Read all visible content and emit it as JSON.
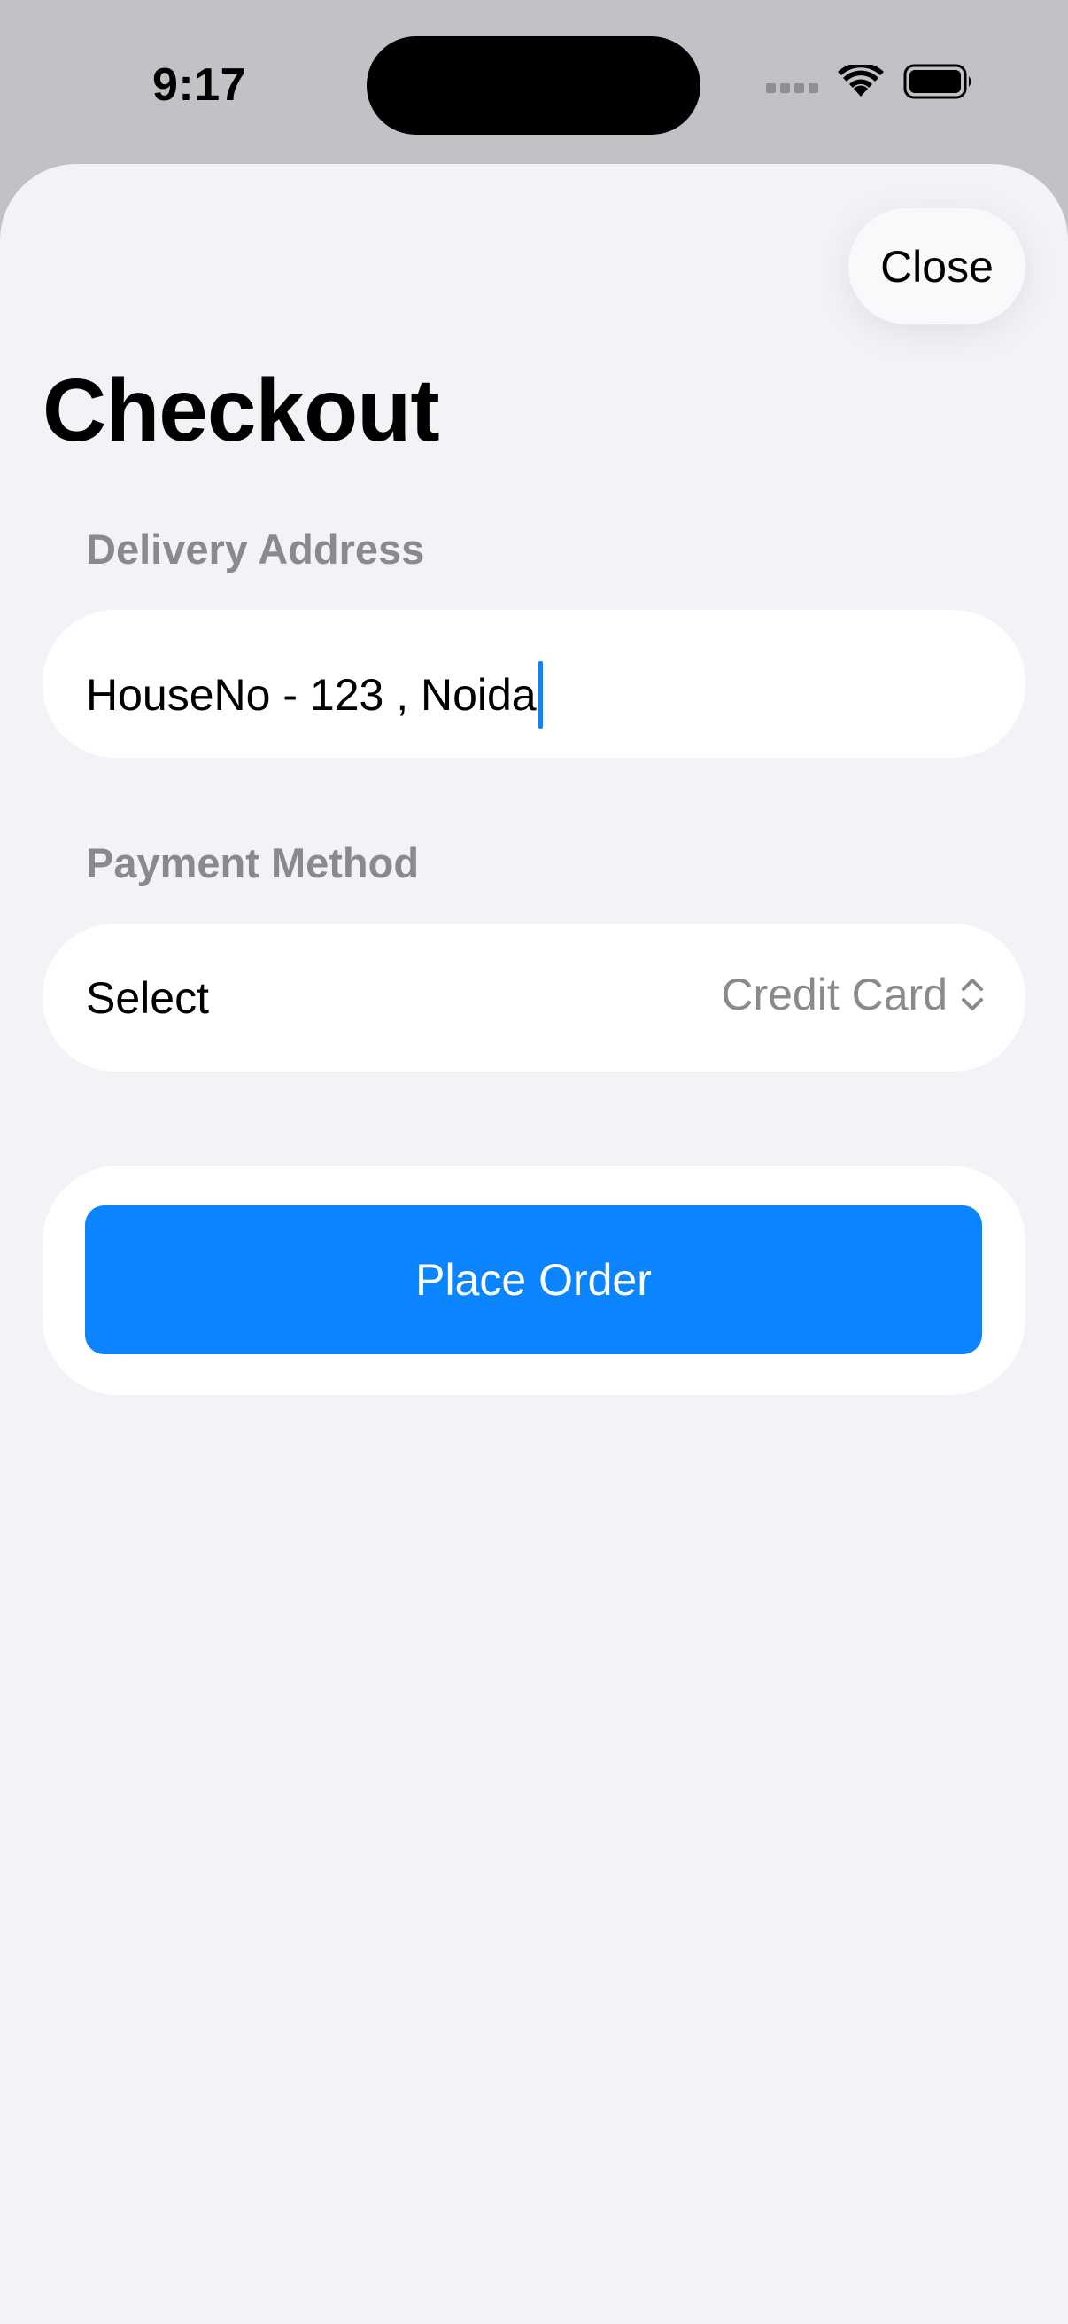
{
  "status_bar": {
    "time": "9:17"
  },
  "sheet": {
    "close_label": "Close",
    "title": "Checkout",
    "delivery": {
      "header": "Delivery Address",
      "value": "HouseNo - 123 , Noida"
    },
    "payment": {
      "header": "Payment Method",
      "label": "Select",
      "selected": "Credit Card"
    },
    "place_order_label": "Place Order"
  },
  "colors": {
    "accent": "#0a84ff",
    "background": "#f2f2f7",
    "secondary_text": "#8a8a8e"
  },
  "icons": [
    "cellular-icon",
    "wifi-icon",
    "battery-icon",
    "chevron-updown-icon"
  ]
}
